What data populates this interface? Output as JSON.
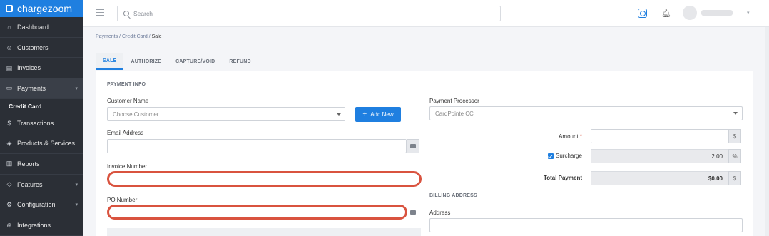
{
  "brand": {
    "name": "chargezoom"
  },
  "sidebar": {
    "items": [
      {
        "label": "Dashboard",
        "icon": "home-icon"
      },
      {
        "label": "Customers",
        "icon": "users-icon"
      },
      {
        "label": "Invoices",
        "icon": "invoice-icon"
      },
      {
        "label": "Payments",
        "icon": "card-icon"
      },
      {
        "label": "Transactions",
        "icon": "dollar-icon"
      },
      {
        "label": "Products & Services",
        "icon": "box-icon"
      },
      {
        "label": "Reports",
        "icon": "chart-icon"
      },
      {
        "label": "Features",
        "icon": "tag-icon"
      },
      {
        "label": "Configuration",
        "icon": "gear-icon"
      },
      {
        "label": "Integrations",
        "icon": "plug-icon"
      }
    ],
    "sub_active": "Credit Card"
  },
  "topbar": {
    "search_placeholder": "Search"
  },
  "breadcrumb": {
    "p1": "Payments",
    "sep": " / ",
    "p2": "Credit Card",
    "p3": "Sale"
  },
  "tabs": [
    "SALE",
    "AUTHORIZE",
    "CAPTURE/VOID",
    "REFUND"
  ],
  "form": {
    "section_payment": "PAYMENT INFO",
    "customer_label": "Customer Name",
    "customer_placeholder": "Choose Customer",
    "add_new": "Add New",
    "email_label": "Email Address",
    "invoice_label": "Invoice Number",
    "po_label": "PO Number",
    "processor_label": "Payment Processor",
    "processor_value": "CardPointe CC",
    "amount_label": "Amount",
    "required": "*",
    "surcharge_label": "Surcharge",
    "surcharge_value": "2.00",
    "percent": "%",
    "dollar": "$",
    "total_label": "Total Payment",
    "total_value": "$0.00",
    "section_billing": "BILLING ADDRESS",
    "address_label": "Address"
  },
  "colors": {
    "accent": "#1f7fe0",
    "highlight": "#d9533f",
    "sidebar": "#2b2f36"
  }
}
